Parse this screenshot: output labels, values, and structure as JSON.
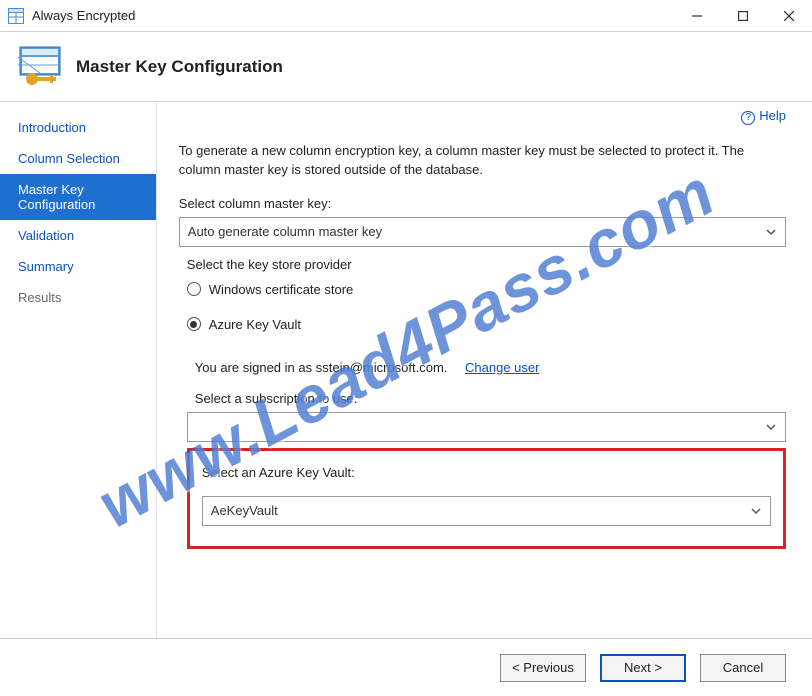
{
  "window": {
    "title": "Always Encrypted"
  },
  "header": {
    "title": "Master Key Configuration"
  },
  "sidebar": {
    "items": [
      {
        "label": "Introduction"
      },
      {
        "label": "Column Selection"
      },
      {
        "label": "Master Key Configuration"
      },
      {
        "label": "Validation"
      },
      {
        "label": "Summary"
      },
      {
        "label": "Results"
      }
    ]
  },
  "content": {
    "help_label": "Help",
    "intro": "To generate a new column encryption key, a column master key must be selected to protect it.  The column master key is stored outside of the database.",
    "cmk_label": "Select column master key:",
    "cmk_selected": "Auto generate column master key",
    "provider_label": "Select the key store provider",
    "radio_win_cert": "Windows certificate store",
    "radio_akv": "Azure Key Vault",
    "signedin_prefix": "You are signed in as ",
    "signedin_user": "sstein@microsoft.com.",
    "change_user": "Change user",
    "subscription_label": "Select a subscription to use:",
    "subscription_selected": "",
    "akv_label": "Select an Azure Key Vault:",
    "akv_selected": "AeKeyVault"
  },
  "footer": {
    "previous": "< Previous",
    "next": "Next >",
    "cancel": "Cancel"
  },
  "watermark": "www.Lead4Pass.com"
}
